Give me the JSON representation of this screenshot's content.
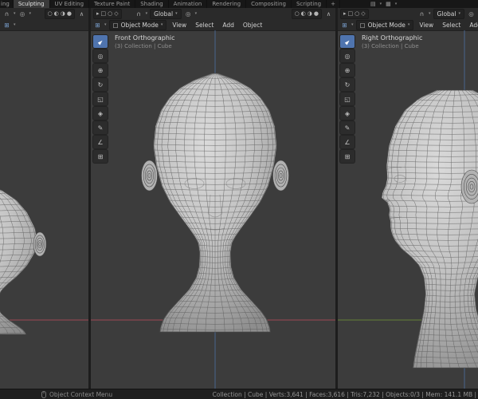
{
  "topbar": {
    "tabs": [
      "ing",
      "Sculpting",
      "UV Editing",
      "Texture Paint",
      "Shading",
      "Animation",
      "Rendering",
      "Compositing",
      "Scripting"
    ],
    "add_tab": "+"
  },
  "viewport_header": {
    "mode_label": "Object Mode",
    "menus": [
      "View",
      "Select",
      "Add",
      "Object"
    ],
    "orientation_label": "Global"
  },
  "viewports": {
    "center": {
      "view_label": "Front Orthographic",
      "context_label": "(3) Collection | Cube"
    },
    "right": {
      "view_label": "Right Orthographic",
      "context_label": "(3) Collection | Cube"
    }
  },
  "statusbar": {
    "left_hint": "Object Context Menu",
    "stats_text": "Collection | Cube | Verts:3,641 | Faces:3,616 | Tris:7,232 | Objects:0/3 | Mem: 141.1 MB |"
  },
  "icons": {
    "caret": "▾",
    "editor_type": "⊞",
    "magnet": "∩",
    "proportional": "◎",
    "overflow": "∧",
    "mode_box": "▢",
    "scene": "▤",
    "layers": "▦",
    "select_cluster": [
      "▸",
      "□",
      "○",
      "◇"
    ],
    "shading_cluster": [
      "○",
      "◐",
      "◑",
      "●"
    ],
    "toolbar": {
      "tweak": "►",
      "cursor": "◎",
      "move": "⊕",
      "rotate": "↻",
      "scale": "◱",
      "transform": "◈",
      "annotate": "✎",
      "measure": "∠",
      "add_cube": "⊞"
    }
  },
  "colors": {
    "accent": "#4f74ae",
    "axis_x": "#b04b58",
    "axis_y": "#6a8f37",
    "axis_z": "#4a6c9b",
    "mesh_fill": "#c4c4c4",
    "wire": "#5a5a5a"
  }
}
